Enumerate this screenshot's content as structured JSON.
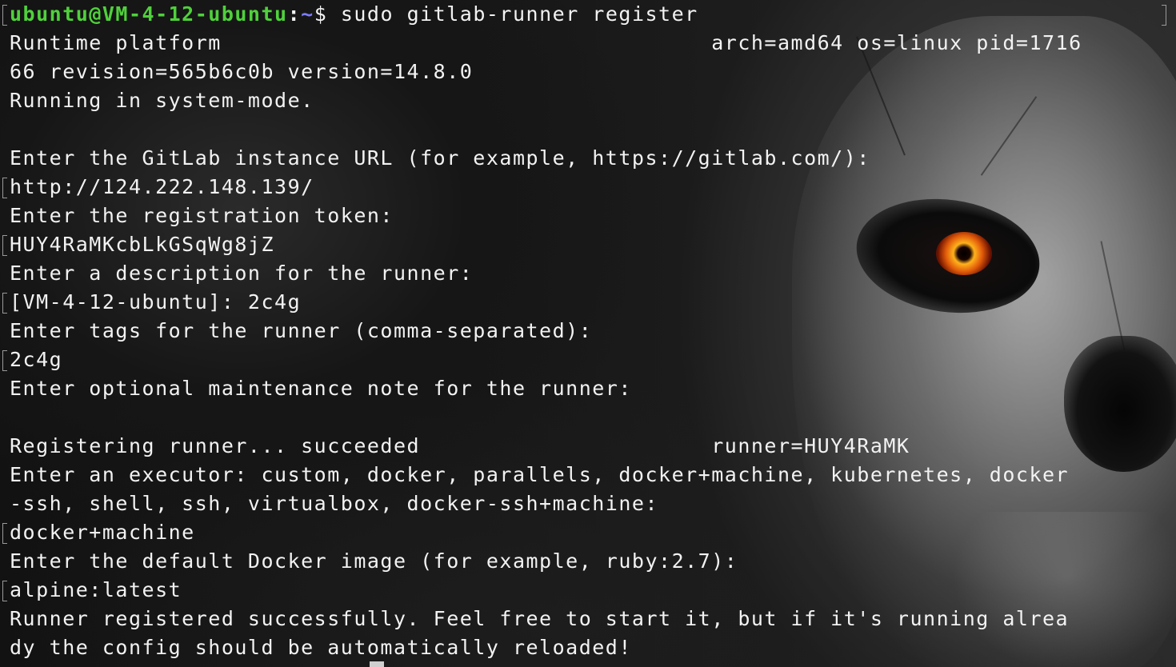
{
  "terminal": {
    "prompt": {
      "user_host": "ubuntu@VM-4-12-ubuntu",
      "separator": ":",
      "path": "~",
      "symbol": "$",
      "command": " sudo gitlab-runner register"
    },
    "output_lines": [
      "Runtime platform                                     arch=amd64 os=linux pid=1716",
      "66 revision=565b6c0b version=14.8.0",
      "Running in system-mode.",
      "",
      "Enter the GitLab instance URL (for example, https://gitlab.com/):",
      "http://124.222.148.139/",
      "Enter the registration token:",
      "HUY4RaMKcbLkGSqWg8jZ",
      "Enter a description for the runner:",
      "[VM-4-12-ubuntu]: 2c4g",
      "Enter tags for the runner (comma-separated):",
      "2c4g",
      "Enter optional maintenance note for the runner:",
      "",
      "Registering runner... succeeded                      runner=HUY4RaMK",
      "Enter an executor: custom, docker, parallels, docker+machine, kubernetes, docker",
      "-ssh, shell, ssh, virtualbox, docker-ssh+machine:",
      "docker+machine",
      "Enter the default Docker image (for example, ruby:2.7):",
      "alpine:latest",
      "Runner registered successfully. Feel free to start it, but if it's running alrea",
      "dy the config should be automatically reloaded!"
    ]
  },
  "colors": {
    "text": "#f2f2f2",
    "user_host": "#4fd13b",
    "path": "#7b7cff"
  }
}
